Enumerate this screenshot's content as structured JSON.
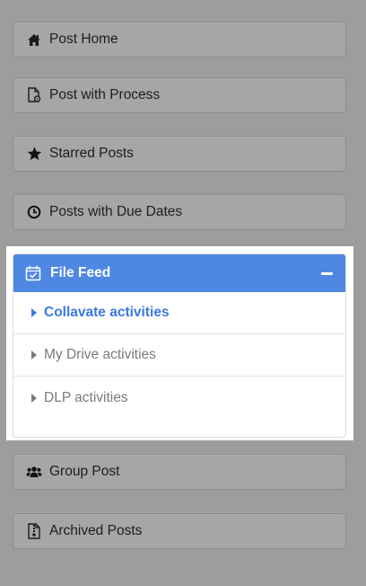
{
  "menu": {
    "items_top": [
      {
        "label": "Post Home",
        "icon": "home-icon"
      },
      {
        "label": "Post with Process",
        "icon": "process-document-icon"
      },
      {
        "label": "Starred Posts",
        "icon": "star-icon"
      },
      {
        "label": "Posts with Due Dates",
        "icon": "clock-icon"
      }
    ],
    "expanded": {
      "label": "File Feed",
      "icon": "calendar-check-icon",
      "collapse_icon": "minus-icon",
      "sub_items": [
        {
          "label": "Collavate activities",
          "active": true
        },
        {
          "label": "My Drive activities",
          "active": false
        },
        {
          "label": "DLP activities",
          "active": false
        }
      ]
    },
    "items_bottom": [
      {
        "label": "Group Post",
        "icon": "users-icon"
      },
      {
        "label": "Archived Posts",
        "icon": "archive-file-icon"
      }
    ]
  },
  "colors": {
    "background": "#9d9d9d",
    "button": "#a6a6a6",
    "accent": "#4f88e3",
    "active_text": "#3b7ae0",
    "inactive_text": "#7a7a7a"
  }
}
